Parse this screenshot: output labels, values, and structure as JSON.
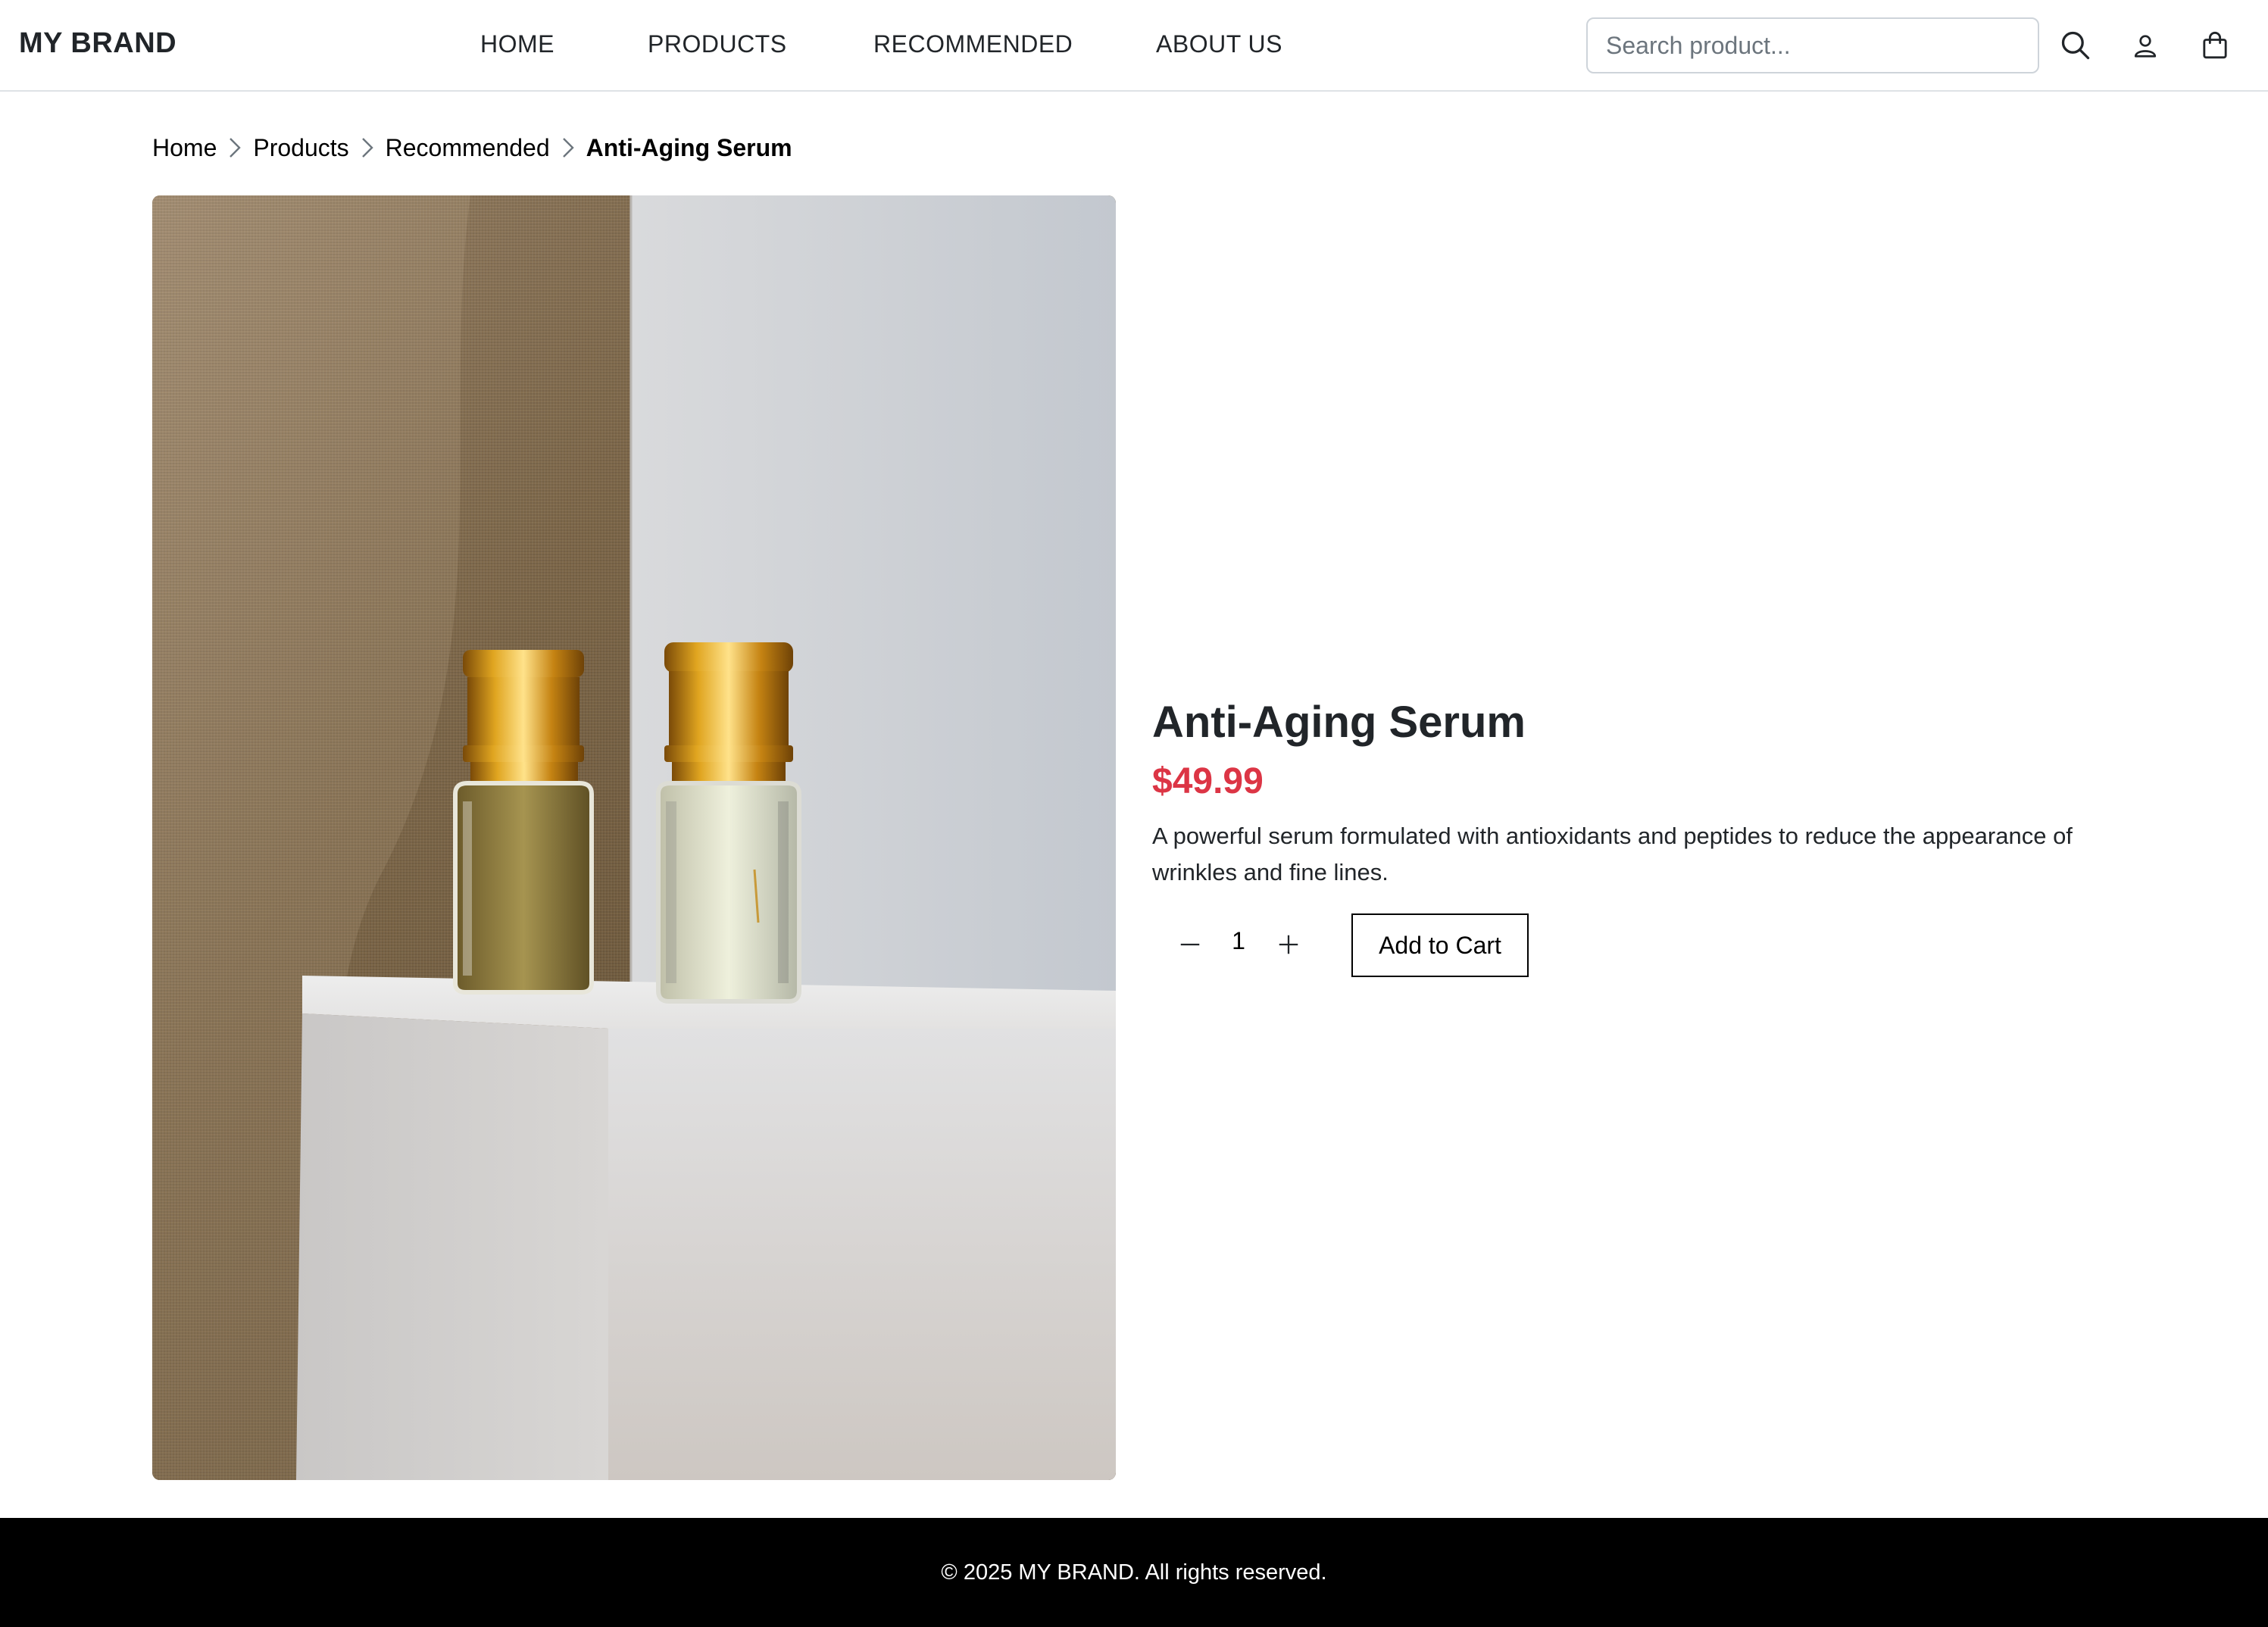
{
  "header": {
    "brand": "MY BRAND",
    "nav": [
      {
        "label": "HOME"
      },
      {
        "label": "PRODUCTS"
      },
      {
        "label": "RECOMMENDED"
      },
      {
        "label": "ABOUT US"
      }
    ],
    "search": {
      "placeholder": "Search product...",
      "value": ""
    },
    "icons": [
      "search-icon",
      "user-icon",
      "shopping-bag-icon"
    ]
  },
  "breadcrumb": {
    "items": [
      "Home",
      "Products",
      "Recommended"
    ],
    "current": "Anti-Aging Serum"
  },
  "product": {
    "image_icon": "product-photo",
    "title": "Anti-Aging Serum",
    "price": "$49.99",
    "description": "A powerful serum formulated with antioxidants and peptides to reduce the appearance of wrinkles and fine lines.",
    "quantity": "1",
    "add_to_cart_label": "Add to Cart"
  },
  "footer": {
    "text": "© 2025 MY BRAND. All rights reserved."
  },
  "colors": {
    "price": "#dc3545",
    "footer_bg": "#000000",
    "text": "#212529"
  }
}
